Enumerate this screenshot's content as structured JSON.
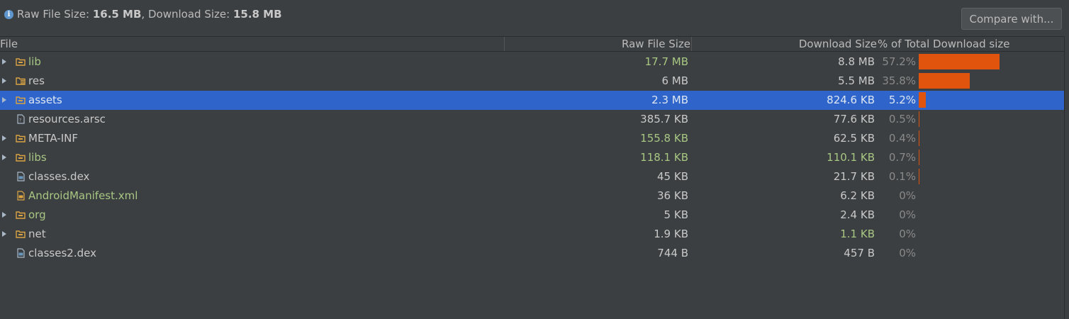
{
  "summary": {
    "raw_label": "Raw File Size: ",
    "raw_value": "16.5 MB",
    "separator": ", ",
    "download_label": "Download Size: ",
    "download_value": "15.8 MB",
    "info_icon": "info-icon",
    "info_glyph": "i"
  },
  "compare_button": {
    "label": "Compare with..."
  },
  "columns": {
    "file": "File",
    "raw": "Raw File Size",
    "download": "Download Size",
    "percent": "% of Total Download size"
  },
  "colors": {
    "background": "#3c3f41",
    "selection": "#2f65ca",
    "bar": "#e0540d",
    "modified_text": "#a8c783"
  },
  "rows": [
    {
      "name": "lib",
      "icon": "folder-icon",
      "expandable": true,
      "raw": "17.7 MB",
      "download": "8.8 MB",
      "percent": "57.2%",
      "share": 0.572,
      "name_color": "green",
      "raw_color": "green",
      "dl_color": "light"
    },
    {
      "name": "res",
      "icon": "resource-folder-icon",
      "expandable": true,
      "raw": "6 MB",
      "download": "5.5 MB",
      "percent": "35.8%",
      "share": 0.358,
      "name_color": "light",
      "raw_color": "light",
      "dl_color": "light"
    },
    {
      "name": "assets",
      "icon": "folder-icon",
      "expandable": true,
      "raw": "2.3 MB",
      "download": "824.6 KB",
      "percent": "5.2%",
      "share": 0.052,
      "selected": true,
      "name_color": "light",
      "raw_color": "light",
      "dl_color": "light"
    },
    {
      "name": "resources.arsc",
      "icon": "file-icon",
      "expandable": false,
      "raw": "385.7 KB",
      "download": "77.6 KB",
      "percent": "0.5%",
      "share": 0.005,
      "name_color": "light",
      "raw_color": "light",
      "dl_color": "light"
    },
    {
      "name": "META-INF",
      "icon": "folder-icon",
      "expandable": true,
      "raw": "155.8 KB",
      "download": "62.5 KB",
      "percent": "0.4%",
      "share": 0.004,
      "name_color": "light",
      "raw_color": "green",
      "dl_color": "light"
    },
    {
      "name": "libs",
      "icon": "folder-icon",
      "expandable": true,
      "raw": "118.1 KB",
      "download": "110.1 KB",
      "percent": "0.7%",
      "share": 0.007,
      "name_color": "green",
      "raw_color": "green",
      "dl_color": "green"
    },
    {
      "name": "classes.dex",
      "icon": "dex-file-icon",
      "expandable": false,
      "raw": "45 KB",
      "download": "21.7 KB",
      "percent": "0.1%",
      "share": 0.001,
      "name_color": "light",
      "raw_color": "light",
      "dl_color": "light"
    },
    {
      "name": "AndroidManifest.xml",
      "icon": "manifest-file-icon",
      "expandable": false,
      "raw": "36 KB",
      "download": "6.2 KB",
      "percent": "0%",
      "share": 0,
      "name_color": "green",
      "raw_color": "light",
      "dl_color": "light"
    },
    {
      "name": "org",
      "icon": "folder-icon",
      "expandable": true,
      "raw": "5 KB",
      "download": "2.4 KB",
      "percent": "0%",
      "share": 0,
      "name_color": "green",
      "raw_color": "light",
      "dl_color": "light"
    },
    {
      "name": "net",
      "icon": "folder-icon",
      "expandable": true,
      "raw": "1.9 KB",
      "download": "1.1 KB",
      "percent": "0%",
      "share": 0,
      "name_color": "light",
      "raw_color": "light",
      "dl_color": "green"
    },
    {
      "name": "classes2.dex",
      "icon": "dex-file-icon",
      "expandable": false,
      "raw": "744 B",
      "download": "457 B",
      "percent": "0%",
      "share": 0,
      "name_color": "light",
      "raw_color": "light",
      "dl_color": "light"
    }
  ]
}
